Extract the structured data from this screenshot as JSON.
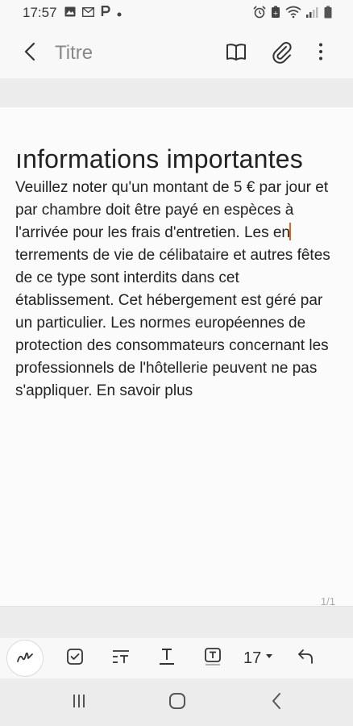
{
  "status_bar": {
    "time": "17:57",
    "left_icons": [
      "image-icon",
      "mail-icon",
      "parking-icon",
      "dot-icon"
    ],
    "right_icons": [
      "alarm-icon",
      "battery-saver-icon",
      "wifi-icon",
      "signal-icon",
      "battery-icon"
    ]
  },
  "header": {
    "title_placeholder": "Titre",
    "actions": [
      "book-icon",
      "attachment-icon",
      "more-options-icon"
    ]
  },
  "note": {
    "title": "ınformations importantes",
    "body_before_cursor": "Veuillez noter qu'un montant de 5 € par jour et par chambre doit être payé en espèces à l'arrivée pour les frais d'entretien. Les en",
    "body_after_cursor": "terrements de vie de célibataire et autres fêtes de ce type sont interdits dans cet établissement. Cet hébergement est géré par un particulier. Les normes européennes de protection des consommateurs concernant les professionnels de l'hôtellerie peuvent ne pas s'appliquer. En savoir plus",
    "page_indicator": "1/1"
  },
  "toolbar": {
    "font_size": "17",
    "tools": [
      "handwriting-icon",
      "checkbox-icon",
      "text-alignment-icon",
      "text-underline-icon",
      "text-box-icon",
      "undo-icon"
    ]
  },
  "colors": {
    "cursor": "#e0651a",
    "background": "#f8f8f8",
    "band": "#ececec"
  }
}
